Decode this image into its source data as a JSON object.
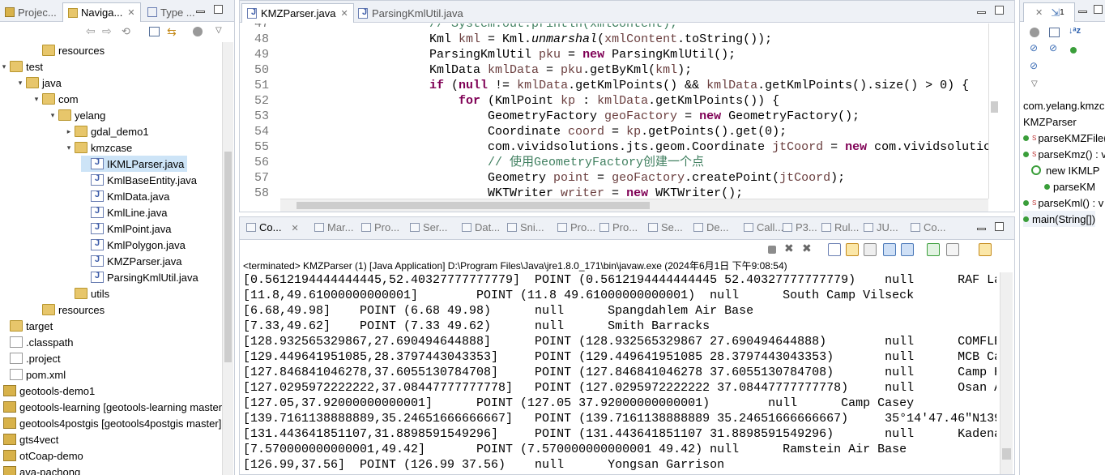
{
  "left": {
    "tabs": [
      "Projec...",
      "Naviga...",
      "Type ..."
    ],
    "tree": [
      {
        "label": "resources",
        "indent": 2,
        "icon": "folder",
        "twisty": ""
      },
      {
        "label": "test",
        "indent": 0,
        "icon": "folder",
        "twisty": "▾"
      },
      {
        "label": "java",
        "indent": 1,
        "icon": "folder",
        "twisty": "▾"
      },
      {
        "label": "com",
        "indent": 2,
        "icon": "folder",
        "twisty": "▾"
      },
      {
        "label": "yelang",
        "indent": 3,
        "icon": "folder",
        "twisty": "▾"
      },
      {
        "label": "gdal_demo1",
        "indent": 4,
        "icon": "folder",
        "twisty": "▸"
      },
      {
        "label": "kmzcase",
        "indent": 4,
        "icon": "folder",
        "twisty": "▾"
      },
      {
        "label": "IKMLParser.java",
        "indent": 5,
        "icon": "java",
        "twisty": "",
        "selected": true
      },
      {
        "label": "KmlBaseEntity.java",
        "indent": 5,
        "icon": "java",
        "twisty": ""
      },
      {
        "label": "KmlData.java",
        "indent": 5,
        "icon": "java",
        "twisty": ""
      },
      {
        "label": "KmlLine.java",
        "indent": 5,
        "icon": "java",
        "twisty": ""
      },
      {
        "label": "KmlPoint.java",
        "indent": 5,
        "icon": "java",
        "twisty": ""
      },
      {
        "label": "KmlPolygon.java",
        "indent": 5,
        "icon": "java",
        "twisty": ""
      },
      {
        "label": "KMZParser.java",
        "indent": 5,
        "icon": "java",
        "twisty": ""
      },
      {
        "label": "ParsingKmlUtil.java",
        "indent": 5,
        "icon": "java",
        "twisty": ""
      },
      {
        "label": "utils",
        "indent": 4,
        "icon": "folder",
        "twisty": ""
      },
      {
        "label": "resources",
        "indent": 2,
        "icon": "folder",
        "twisty": ""
      },
      {
        "label": "target",
        "indent": 0,
        "icon": "folder",
        "twisty": ""
      },
      {
        "label": ".classpath",
        "indent": 0,
        "icon": "file",
        "twisty": ""
      },
      {
        "label": ".project",
        "indent": 0,
        "icon": "file",
        "twisty": ""
      },
      {
        "label": "pom.xml",
        "indent": 0,
        "icon": "file",
        "twisty": ""
      },
      {
        "label": "geotools-demo1",
        "indent": -1,
        "icon": "proj",
        "twisty": ""
      },
      {
        "label": "geotools-learning [geotools-learning master",
        "indent": -1,
        "icon": "proj",
        "twisty": ""
      },
      {
        "label": "geotools4postgis [geotools4postgis master]",
        "indent": -1,
        "icon": "proj",
        "twisty": ""
      },
      {
        "label": "gts4vect",
        "indent": -1,
        "icon": "proj",
        "twisty": ""
      },
      {
        "label": "otCoap-demo",
        "indent": -1,
        "icon": "proj",
        "twisty": ""
      },
      {
        "label": "ava-pachong",
        "indent": -1,
        "icon": "proj",
        "twisty": ""
      }
    ]
  },
  "editor": {
    "tabs": [
      "KMZParser.java",
      "ParsingKmlUtil.java"
    ],
    "lines": [
      {
        "n": "47",
        "html": "<span class=\"cm\">// System.out.println(xmlContent);</span>"
      },
      {
        "n": "48",
        "html": "Kml <span class=\"var\">kml</span> = Kml.<span class=\"it\">unmarshal</span>(<span class=\"var\">xmlContent</span>.toString());"
      },
      {
        "n": "49",
        "html": "ParsingKmlUtil <span class=\"var\">pku</span> = <span class=\"kw\">new</span> ParsingKmlUtil();"
      },
      {
        "n": "50",
        "html": "KmlData <span class=\"var\">kmlData</span> = <span class=\"var\">pku</span>.getByKml(<span class=\"var\">kml</span>);"
      },
      {
        "n": "51",
        "html": "<span class=\"kw\">if</span> (<span class=\"kw\">null</span> != <span class=\"var\">kmlData</span>.getKmlPoints() &amp;&amp; <span class=\"var\">kmlData</span>.getKmlPoints().size() &gt; 0) {"
      },
      {
        "n": "52",
        "html": "    <span class=\"kw\">for</span> (KmlPoint <span class=\"var\">kp</span> : <span class=\"var\">kmlData</span>.getKmlPoints()) {"
      },
      {
        "n": "53",
        "html": "        GeometryFactory <span class=\"var\">geoFactory</span> = <span class=\"kw\">new</span> GeometryFactory();"
      },
      {
        "n": "54",
        "html": "        Coordinate <span class=\"var\">coord</span> = <span class=\"var\">kp</span>.getPoints().get(0);"
      },
      {
        "n": "55",
        "html": "        com.vividsolutions.jts.geom.Coordinate <span class=\"var\">jtCoord</span> = <span class=\"kw\">new</span> com.vividsolutic"
      },
      {
        "n": "56",
        "html": "        <span class=\"cm\">// 使用GeometryFactory创建一个点</span>"
      },
      {
        "n": "57",
        "html": "        Geometry <span class=\"var\">point</span> = <span class=\"var\">geoFactory</span>.createPoint(<span class=\"var\">jtCoord</span>);"
      },
      {
        "n": "58",
        "html": "        WKTWriter <span class=\"var\">writer</span> = <span class=\"kw\">new</span> WKTWriter();"
      }
    ]
  },
  "console": {
    "tabs": [
      "Co...",
      "Mar...",
      "Pro...",
      "Ser...",
      "Dat...",
      "Sni...",
      "Pro...",
      "Pro...",
      "Se...",
      "De...",
      "Call...",
      "P3...",
      "Rul...",
      "JU...",
      "Co..."
    ],
    "status": "<terminated> KMZParser (1) [Java Application] D:\\Program Files\\Java\\jre1.8.0_171\\bin\\javaw.exe (2024年6月1日 下午9:08:54)",
    "lines": [
      "[0.5612194444444445,52.40327777777779]  POINT (0.5612194444444445 52.40327777777779)    null      RAF La",
      "[11.8,49.61000000000001]        POINT (11.8 49.61000000000001)  null      South Camp Vilseck",
      "[6.68,49.98]    POINT (6.68 49.98)      null      Spangdahlem Air Base",
      "[7.33,49.62]    POINT (7.33 49.62)      null      Smith Barracks",
      "[128.932565329867,27.690494644888]      POINT (128.932565329867 27.690494644888)        null      COMFLE",
      "[129.449641951085,28.3797443043353]     POINT (129.449641951085 28.3797443043353)       null      MCB Ca",
      "[127.846841046278,37.6055130784708]     POINT (127.846841046278 37.6055130784708)       null      Camp H",
      "[127.0295972222222,37.08447777777778]   POINT (127.0295972222222 37.08447777777778)     null      Osan A",
      "[127.05,37.92000000000001]      POINT (127.05 37.92000000000001)        null      Camp Casey",
      "[139.7161138888889,35.24651666666667]   POINT (139.7161138888889 35.24651666666667)     35°14'47.46\"N139",
      "[131.443641851107,31.8898591549296]     POINT (131.443641851107 31.8898591549296)       null      Kadena",
      "[7.570000000000001,49.42]       POINT (7.570000000000001 49.42) null      Ramstein Air Base",
      "[126.99,37.56]  POINT (126.99 37.56)    null      Yongsan Garrison"
    ]
  },
  "outline": {
    "tab": "1",
    "items": [
      {
        "label": "com.yelang.kmzc",
        "marker": ""
      },
      {
        "label": "KMZParser",
        "marker": ""
      },
      {
        "label": "parseKMZFile(",
        "marker": "dot"
      },
      {
        "label": "parseKmz() : v",
        "marker": "dot"
      },
      {
        "label": "new IKMLP",
        "marker": "c"
      },
      {
        "label": "parseKM",
        "marker": "dot"
      },
      {
        "label": "parseKml() : v",
        "marker": "dot"
      },
      {
        "label": "main(String[])",
        "marker": "dot"
      }
    ]
  }
}
